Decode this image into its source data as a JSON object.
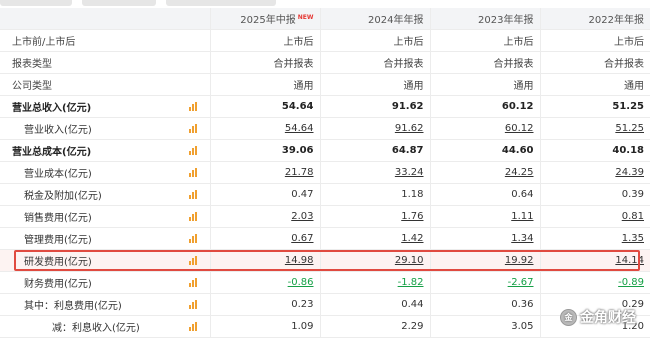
{
  "periods": {
    "p2025": "2025年中报",
    "p2025_badge": "NEW",
    "p2024": "2024年年报",
    "p2023": "2023年年报",
    "p2022": "2022年年报"
  },
  "meta": {
    "listing": {
      "label": "上市前/上市后",
      "p2025": "上市后",
      "p2024": "上市后",
      "p2023": "上市后",
      "p2022": "上市后"
    },
    "report_type": {
      "label": "报表类型",
      "p2025": "合并报表",
      "p2024": "合并报表",
      "p2023": "合并报表",
      "p2022": "合并报表"
    },
    "company_type": {
      "label": "公司类型",
      "p2025": "通用",
      "p2024": "通用",
      "p2023": "通用",
      "p2022": "通用"
    }
  },
  "rows": {
    "total_revenue": {
      "label": "营业总收入(亿元)",
      "p2025": "54.64",
      "p2024": "91.62",
      "p2023": "60.12",
      "p2022": "51.25"
    },
    "revenue": {
      "label": "营业收入(亿元)",
      "p2025": "54.64",
      "p2024": "91.62",
      "p2023": "60.12",
      "p2022": "51.25"
    },
    "total_cost": {
      "label": "营业总成本(亿元)",
      "p2025": "39.06",
      "p2024": "64.87",
      "p2023": "44.60",
      "p2022": "40.18"
    },
    "op_cost": {
      "label": "营业成本(亿元)",
      "p2025": "21.78",
      "p2024": "33.24",
      "p2023": "24.25",
      "p2022": "24.39"
    },
    "tax": {
      "label": "税金及附加(亿元)",
      "p2025": "0.47",
      "p2024": "1.18",
      "p2023": "0.64",
      "p2022": "0.39"
    },
    "selling": {
      "label": "销售费用(亿元)",
      "p2025": "2.03",
      "p2024": "1.76",
      "p2023": "1.11",
      "p2022": "0.81"
    },
    "admin": {
      "label": "管理费用(亿元)",
      "p2025": "0.67",
      "p2024": "1.42",
      "p2023": "1.34",
      "p2022": "1.35"
    },
    "rnd": {
      "label": "研发费用(亿元)",
      "p2025": "14.98",
      "p2024": "29.10",
      "p2023": "19.92",
      "p2022": "14.14"
    },
    "finance": {
      "label": "财务费用(亿元)",
      "p2025": "-0.86",
      "p2024": "-1.82",
      "p2023": "-2.67",
      "p2022": "-0.89"
    },
    "interest_exp": {
      "label": "其中：利息费用(亿元)",
      "p2025": "0.23",
      "p2024": "0.44",
      "p2023": "0.36",
      "p2022": "0.29"
    },
    "interest_inc": {
      "label": "减：利息收入(亿元)",
      "p2025": "1.09",
      "p2024": "2.29",
      "p2023": "3.05",
      "p2022": "1.20"
    }
  },
  "icons": {
    "trend": "bar-chart-icon"
  },
  "colors": {
    "highlight_border": "#e04a40",
    "negative": "#15a046",
    "icon": "#f0a030"
  },
  "watermark": {
    "text": "金角财经",
    "logo": "金"
  }
}
